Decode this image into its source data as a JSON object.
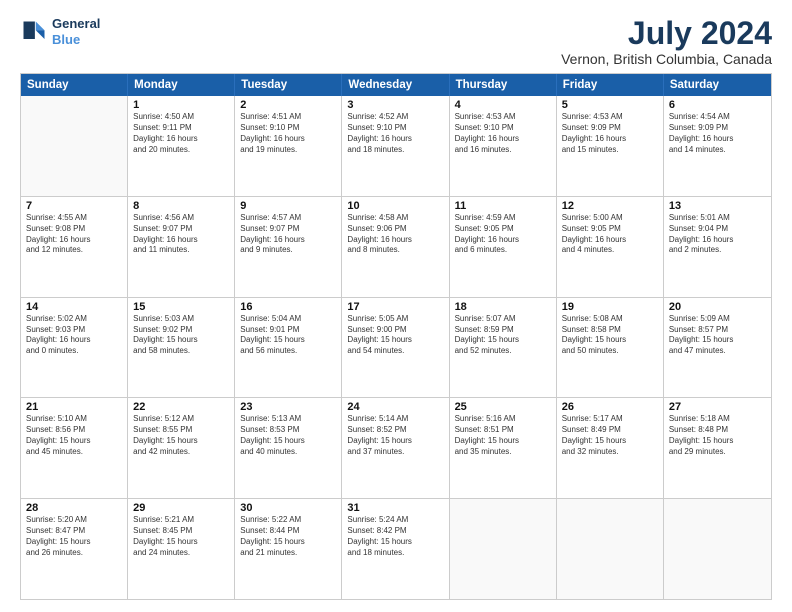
{
  "header": {
    "logo_line1": "General",
    "logo_line2": "Blue",
    "title": "July 2024",
    "subtitle": "Vernon, British Columbia, Canada"
  },
  "weekdays": [
    "Sunday",
    "Monday",
    "Tuesday",
    "Wednesday",
    "Thursday",
    "Friday",
    "Saturday"
  ],
  "rows": [
    [
      {
        "day": "",
        "lines": []
      },
      {
        "day": "1",
        "lines": [
          "Sunrise: 4:50 AM",
          "Sunset: 9:11 PM",
          "Daylight: 16 hours",
          "and 20 minutes."
        ]
      },
      {
        "day": "2",
        "lines": [
          "Sunrise: 4:51 AM",
          "Sunset: 9:10 PM",
          "Daylight: 16 hours",
          "and 19 minutes."
        ]
      },
      {
        "day": "3",
        "lines": [
          "Sunrise: 4:52 AM",
          "Sunset: 9:10 PM",
          "Daylight: 16 hours",
          "and 18 minutes."
        ]
      },
      {
        "day": "4",
        "lines": [
          "Sunrise: 4:53 AM",
          "Sunset: 9:10 PM",
          "Daylight: 16 hours",
          "and 16 minutes."
        ]
      },
      {
        "day": "5",
        "lines": [
          "Sunrise: 4:53 AM",
          "Sunset: 9:09 PM",
          "Daylight: 16 hours",
          "and 15 minutes."
        ]
      },
      {
        "day": "6",
        "lines": [
          "Sunrise: 4:54 AM",
          "Sunset: 9:09 PM",
          "Daylight: 16 hours",
          "and 14 minutes."
        ]
      }
    ],
    [
      {
        "day": "7",
        "lines": [
          "Sunrise: 4:55 AM",
          "Sunset: 9:08 PM",
          "Daylight: 16 hours",
          "and 12 minutes."
        ]
      },
      {
        "day": "8",
        "lines": [
          "Sunrise: 4:56 AM",
          "Sunset: 9:07 PM",
          "Daylight: 16 hours",
          "and 11 minutes."
        ]
      },
      {
        "day": "9",
        "lines": [
          "Sunrise: 4:57 AM",
          "Sunset: 9:07 PM",
          "Daylight: 16 hours",
          "and 9 minutes."
        ]
      },
      {
        "day": "10",
        "lines": [
          "Sunrise: 4:58 AM",
          "Sunset: 9:06 PM",
          "Daylight: 16 hours",
          "and 8 minutes."
        ]
      },
      {
        "day": "11",
        "lines": [
          "Sunrise: 4:59 AM",
          "Sunset: 9:05 PM",
          "Daylight: 16 hours",
          "and 6 minutes."
        ]
      },
      {
        "day": "12",
        "lines": [
          "Sunrise: 5:00 AM",
          "Sunset: 9:05 PM",
          "Daylight: 16 hours",
          "and 4 minutes."
        ]
      },
      {
        "day": "13",
        "lines": [
          "Sunrise: 5:01 AM",
          "Sunset: 9:04 PM",
          "Daylight: 16 hours",
          "and 2 minutes."
        ]
      }
    ],
    [
      {
        "day": "14",
        "lines": [
          "Sunrise: 5:02 AM",
          "Sunset: 9:03 PM",
          "Daylight: 16 hours",
          "and 0 minutes."
        ]
      },
      {
        "day": "15",
        "lines": [
          "Sunrise: 5:03 AM",
          "Sunset: 9:02 PM",
          "Daylight: 15 hours",
          "and 58 minutes."
        ]
      },
      {
        "day": "16",
        "lines": [
          "Sunrise: 5:04 AM",
          "Sunset: 9:01 PM",
          "Daylight: 15 hours",
          "and 56 minutes."
        ]
      },
      {
        "day": "17",
        "lines": [
          "Sunrise: 5:05 AM",
          "Sunset: 9:00 PM",
          "Daylight: 15 hours",
          "and 54 minutes."
        ]
      },
      {
        "day": "18",
        "lines": [
          "Sunrise: 5:07 AM",
          "Sunset: 8:59 PM",
          "Daylight: 15 hours",
          "and 52 minutes."
        ]
      },
      {
        "day": "19",
        "lines": [
          "Sunrise: 5:08 AM",
          "Sunset: 8:58 PM",
          "Daylight: 15 hours",
          "and 50 minutes."
        ]
      },
      {
        "day": "20",
        "lines": [
          "Sunrise: 5:09 AM",
          "Sunset: 8:57 PM",
          "Daylight: 15 hours",
          "and 47 minutes."
        ]
      }
    ],
    [
      {
        "day": "21",
        "lines": [
          "Sunrise: 5:10 AM",
          "Sunset: 8:56 PM",
          "Daylight: 15 hours",
          "and 45 minutes."
        ]
      },
      {
        "day": "22",
        "lines": [
          "Sunrise: 5:12 AM",
          "Sunset: 8:55 PM",
          "Daylight: 15 hours",
          "and 42 minutes."
        ]
      },
      {
        "day": "23",
        "lines": [
          "Sunrise: 5:13 AM",
          "Sunset: 8:53 PM",
          "Daylight: 15 hours",
          "and 40 minutes."
        ]
      },
      {
        "day": "24",
        "lines": [
          "Sunrise: 5:14 AM",
          "Sunset: 8:52 PM",
          "Daylight: 15 hours",
          "and 37 minutes."
        ]
      },
      {
        "day": "25",
        "lines": [
          "Sunrise: 5:16 AM",
          "Sunset: 8:51 PM",
          "Daylight: 15 hours",
          "and 35 minutes."
        ]
      },
      {
        "day": "26",
        "lines": [
          "Sunrise: 5:17 AM",
          "Sunset: 8:49 PM",
          "Daylight: 15 hours",
          "and 32 minutes."
        ]
      },
      {
        "day": "27",
        "lines": [
          "Sunrise: 5:18 AM",
          "Sunset: 8:48 PM",
          "Daylight: 15 hours",
          "and 29 minutes."
        ]
      }
    ],
    [
      {
        "day": "28",
        "lines": [
          "Sunrise: 5:20 AM",
          "Sunset: 8:47 PM",
          "Daylight: 15 hours",
          "and 26 minutes."
        ]
      },
      {
        "day": "29",
        "lines": [
          "Sunrise: 5:21 AM",
          "Sunset: 8:45 PM",
          "Daylight: 15 hours",
          "and 24 minutes."
        ]
      },
      {
        "day": "30",
        "lines": [
          "Sunrise: 5:22 AM",
          "Sunset: 8:44 PM",
          "Daylight: 15 hours",
          "and 21 minutes."
        ]
      },
      {
        "day": "31",
        "lines": [
          "Sunrise: 5:24 AM",
          "Sunset: 8:42 PM",
          "Daylight: 15 hours",
          "and 18 minutes."
        ]
      },
      {
        "day": "",
        "lines": []
      },
      {
        "day": "",
        "lines": []
      },
      {
        "day": "",
        "lines": []
      }
    ]
  ]
}
